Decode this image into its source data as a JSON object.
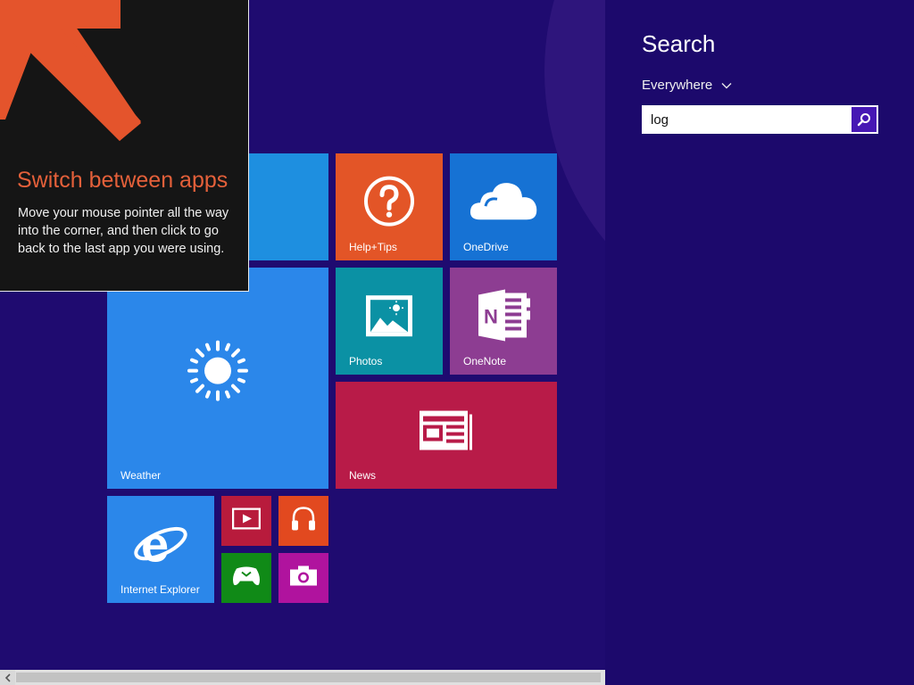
{
  "tip": {
    "title": "Switch between apps",
    "body": "Move your mouse pointer all the way into the corner, and then click to go back to the last app you were using."
  },
  "tiles": {
    "help_tips": "Help+Tips",
    "onedrive": "OneDrive",
    "photos": "Photos",
    "onenote": "OneNote",
    "weather": "Weather",
    "news": "News",
    "internet_explorer": "Internet Explorer"
  },
  "search": {
    "title": "Search",
    "scope": "Everywhere",
    "query": "log"
  },
  "colors": {
    "background": "#1f0b70",
    "tip_accent": "#e4603a",
    "search_button": "#4617b4"
  }
}
